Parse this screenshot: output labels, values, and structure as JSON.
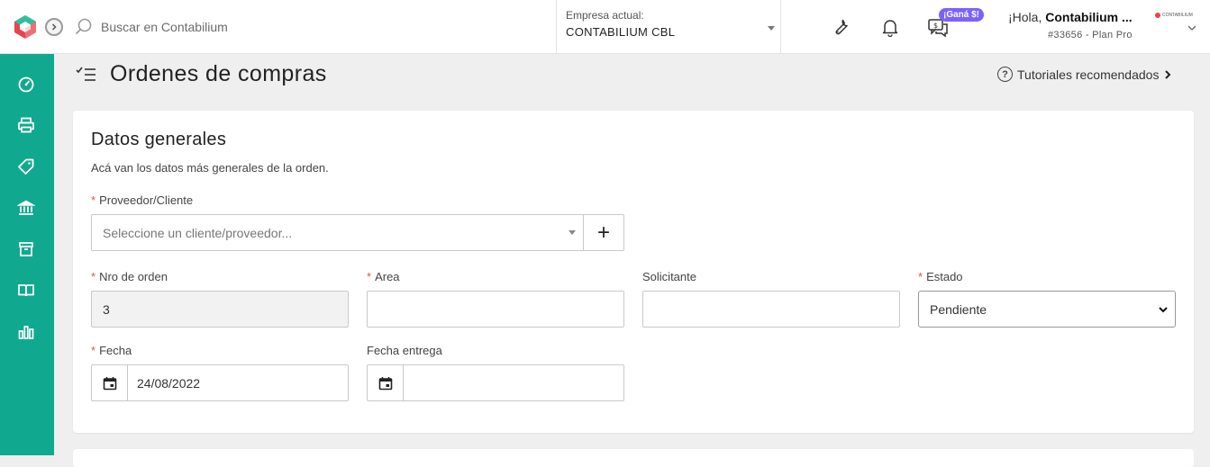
{
  "search": {
    "placeholder": "Buscar en Contabilium"
  },
  "company": {
    "label": "Empresa actual:",
    "value": "CONTABILIUM CBL"
  },
  "promo": {
    "badge": "¡Ganá $!"
  },
  "user": {
    "greeting": "¡Hola,",
    "name": "Contabilium ...",
    "plan": "#33656 - Plan Pro",
    "logo_text": "CONTABILIUM"
  },
  "colors": {
    "sidebar": "#10a98f",
    "badge": "#7b61ff",
    "required": "#e05252"
  },
  "sidebar": {
    "items": [
      {
        "icon": "dashboard-icon"
      },
      {
        "icon": "printer-icon"
      },
      {
        "icon": "tag-icon"
      },
      {
        "icon": "bank-icon"
      },
      {
        "icon": "box-icon"
      },
      {
        "icon": "book-icon"
      },
      {
        "icon": "bar-chart-icon"
      }
    ]
  },
  "page": {
    "title": "Ordenes de compras",
    "tutorials": "Tutoriales recomendados"
  },
  "section": {
    "title": "Datos generales",
    "subtitle": "Acá van los datos más generales de la orden.",
    "provider": {
      "label": "Proveedor/Cliente",
      "placeholder": "Seleccione un cliente/proveedor...",
      "add": "+"
    },
    "order_number": {
      "label": "Nro de orden",
      "value": "3"
    },
    "area": {
      "label": "Area",
      "value": ""
    },
    "requester": {
      "label": "Solicitante",
      "value": ""
    },
    "status": {
      "label": "Estado",
      "value": "Pendiente"
    },
    "date": {
      "label": "Fecha",
      "value": "24/08/2022"
    },
    "delivery_date": {
      "label": "Fecha entrega",
      "value": ""
    }
  }
}
